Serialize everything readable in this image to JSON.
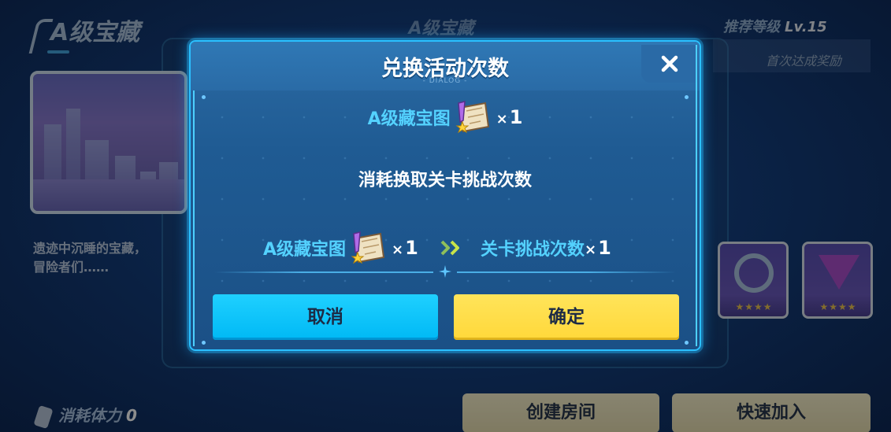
{
  "background": {
    "page_title": "A级宝藏",
    "center_title": "A级宝藏",
    "description": "遗迹中沉睡的宝藏，",
    "description_line2": "冒险者们……",
    "recommended_level_label": "推荐等级",
    "recommended_level_value": "Lv.15",
    "first_clear_reward_label": "首次达成奖励",
    "stamina_label": "消耗体力",
    "stamina_value": "0",
    "create_room_label": "创建房间",
    "quick_join_label": "快速加入",
    "reward_stars": "★★★★"
  },
  "dialog": {
    "title": "兑换活动次数",
    "subtitle": "- DIALOG -",
    "cost_item_name": "A级藏宝图",
    "cost_qty_x": "×",
    "cost_qty": "1",
    "description": "消耗换取关卡挑战次数",
    "exchange_from_name": "A级藏宝图",
    "exchange_from_qty": "1",
    "exchange_to_name": "关卡挑战次数",
    "exchange_to_qty": "1",
    "qty_prefix": "×",
    "cancel_label": "取消",
    "confirm_label": "确定"
  },
  "colors": {
    "accent_cyan": "#00c4ff",
    "confirm_yellow": "#ffdc3c",
    "item_name_blue": "#54d2ff",
    "dialog_border": "#2bc0ff"
  },
  "icons": [
    "close-icon",
    "treasure-map-icon",
    "double-chevron-right-icon",
    "sparkle-icon",
    "phone-icon"
  ]
}
